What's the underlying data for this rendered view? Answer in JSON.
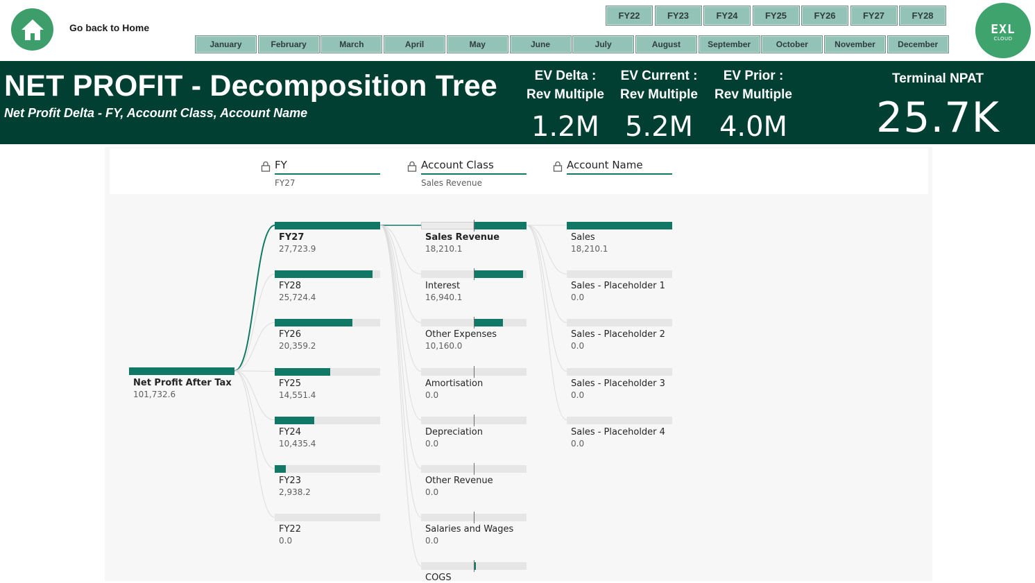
{
  "nav": {
    "home_label": "Go back to Home"
  },
  "fiscal_years": [
    "FY22",
    "FY23",
    "FY24",
    "FY25",
    "FY26",
    "FY27",
    "FY28"
  ],
  "months": [
    "January",
    "February",
    "March",
    "April",
    "May",
    "June",
    "July",
    "August",
    "September",
    "October",
    "November",
    "December"
  ],
  "logo": {
    "text": "EXL",
    "subtext": "CLOUD"
  },
  "banner": {
    "title": "NET PROFIT - Decomposition Tree",
    "subtitle": "Net Profit Delta - FY, Account Class, Account Name"
  },
  "kpis": [
    {
      "line1": "EV Delta :",
      "line2": "Rev Multiple",
      "value": "1.2M"
    },
    {
      "line1": "EV Current :",
      "line2": "Rev Multiple",
      "value": "5.2M"
    },
    {
      "line1": "EV Prior :",
      "line2": "Rev Multiple",
      "value": "4.0M"
    }
  ],
  "terminal": {
    "label": "Terminal NPAT",
    "value": "25.7K"
  },
  "tree": {
    "levels": [
      {
        "name": "FY",
        "selected": "FY27"
      },
      {
        "name": "Account Class",
        "selected": "Sales Revenue"
      },
      {
        "name": "Account Name",
        "selected": ""
      }
    ],
    "root": {
      "label": "Net Profit After Tax",
      "value": "101,732.6",
      "fraction": 1.0
    },
    "fy_nodes": [
      {
        "label": "FY27",
        "value": "27,723.9",
        "fraction": 1.0,
        "selected": true
      },
      {
        "label": "FY28",
        "value": "25,724.4",
        "fraction": 0.928
      },
      {
        "label": "FY26",
        "value": "20,359.2",
        "fraction": 0.734
      },
      {
        "label": "FY25",
        "value": "14,551.4",
        "fraction": 0.525
      },
      {
        "label": "FY24",
        "value": "10,435.4",
        "fraction": 0.376
      },
      {
        "label": "FY23",
        "value": "2,938.2",
        "fraction": 0.106
      },
      {
        "label": "FY22",
        "value": "0.0",
        "fraction": 0.0
      }
    ],
    "class_nodes": [
      {
        "label": "Sales Revenue",
        "value": "18,210.1",
        "fraction": 0.5,
        "negative_fraction": 0.5,
        "selected": true
      },
      {
        "label": "Interest",
        "value": "16,940.1",
        "fraction": 0.465
      },
      {
        "label": "Other Expenses",
        "value": "10,160.0",
        "fraction": 0.279
      },
      {
        "label": "Amortisation",
        "value": "0.0",
        "fraction": 0.0
      },
      {
        "label": "Depreciation",
        "value": "0.0",
        "fraction": 0.0
      },
      {
        "label": "Other Revenue",
        "value": "0.0",
        "fraction": 0.0
      },
      {
        "label": "Salaries and Wages",
        "value": "0.0",
        "fraction": 0.0
      },
      {
        "label": "COGS",
        "value": "",
        "fraction": 0.02
      }
    ],
    "name_nodes": [
      {
        "label": "Sales",
        "value": "18,210.1",
        "fraction": 1.0
      },
      {
        "label": "Sales - Placeholder 1",
        "value": "0.0",
        "fraction": 0.0
      },
      {
        "label": "Sales - Placeholder 2",
        "value": "0.0",
        "fraction": 0.0
      },
      {
        "label": "Sales - Placeholder 3",
        "value": "0.0",
        "fraction": 0.0
      },
      {
        "label": "Sales - Placeholder 4",
        "value": "0.0",
        "fraction": 0.0
      }
    ]
  },
  "colors": {
    "accent": "#117865",
    "banner": "#003f32",
    "home": "#3e9e6b",
    "slicer": "#93c2b6"
  }
}
